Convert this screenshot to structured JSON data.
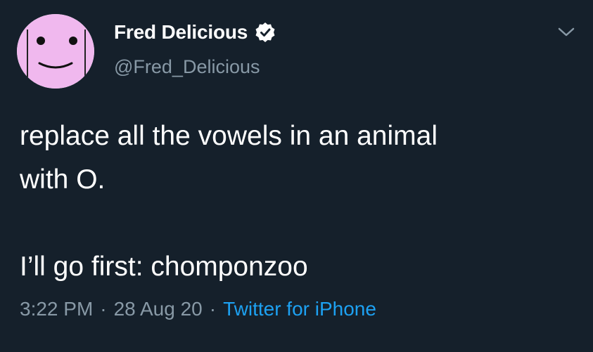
{
  "user": {
    "display_name": "Fred Delicious",
    "handle": "@Fred_Delicious",
    "verified": true,
    "avatar_icon": "pink-smiley-face-avatar"
  },
  "tweet": {
    "lines": [
      "replace all the vowels in an animal",
      "with O."
    ],
    "second_paragraph": "I’ll go first: chomponzoo",
    "time": "3:22 PM",
    "date": "28 Aug 20",
    "separator": "·",
    "source": "Twitter for iPhone"
  },
  "colors": {
    "background": "#15202b",
    "primary_text": "#ffffff",
    "secondary_text": "#8899a6",
    "accent": "#1da1f2",
    "avatar_fill": "#f0b8ee"
  }
}
